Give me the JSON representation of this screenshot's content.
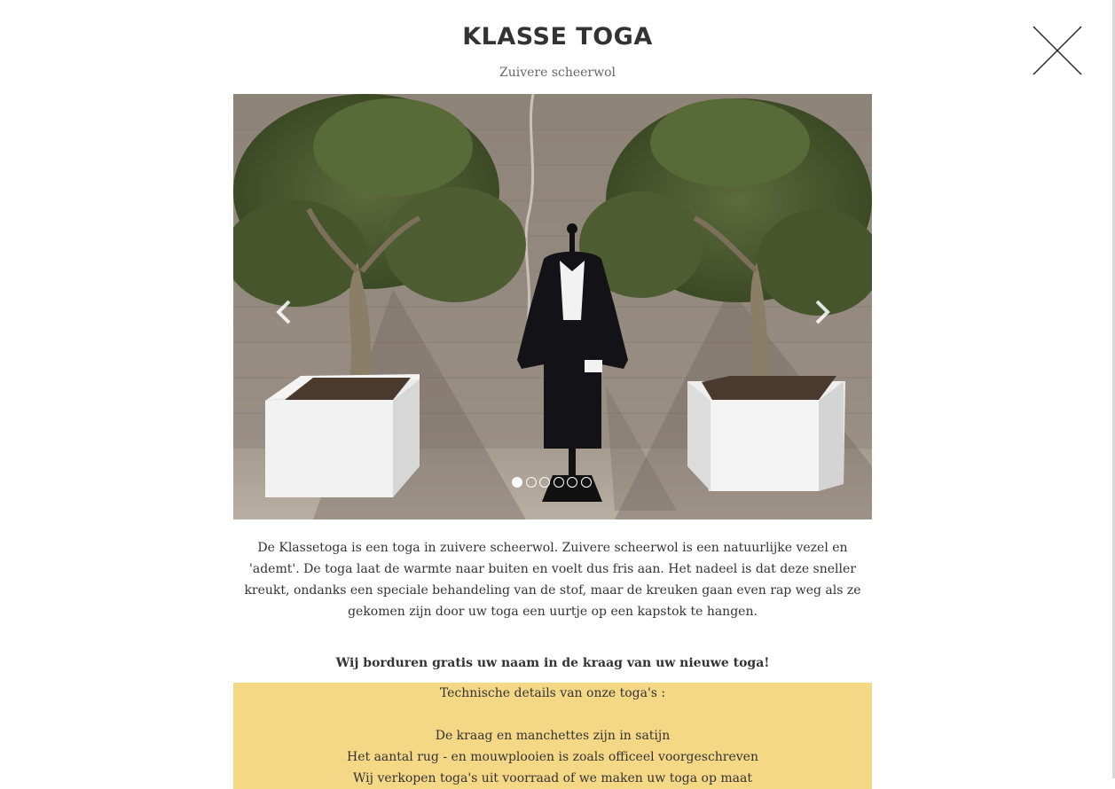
{
  "header": {
    "title": "KLASSE TOGA",
    "subtitle": "Zuivere scheerwol",
    "close_icon": "close-icon"
  },
  "carousel": {
    "slide_count": 6,
    "active_index": 0,
    "prev_icon": "chevron-left-icon",
    "next_icon": "chevron-right-icon"
  },
  "description": "De Klassetoga is een toga in zuivere scheerwol. Zuivere scheerwol is een natuurlijke vezel en 'ademt'. De toga laat de warmte naar buiten en voelt dus fris aan. Het nadeel is dat deze sneller kreukt, ondanks een speciale behandeling van de stof, maar de kreuken gaan even rap weg als ze gekomen zijn door uw toga een uurtje op een kapstok te hangen.",
  "promo": "Wij borduren gratis uw naam in de kraag van uw nieuwe toga!",
  "tech": {
    "heading": "Technische details van onze toga's :",
    "lines": [
      "De kraag en manchettes zijn in satijn",
      "Het aantal rug - en mouwplooien is zoals officeel voorgeschreven",
      "Wij verkopen toga's uit voorraad of we maken uw toga op maat"
    ],
    "background": "#f5d885"
  }
}
